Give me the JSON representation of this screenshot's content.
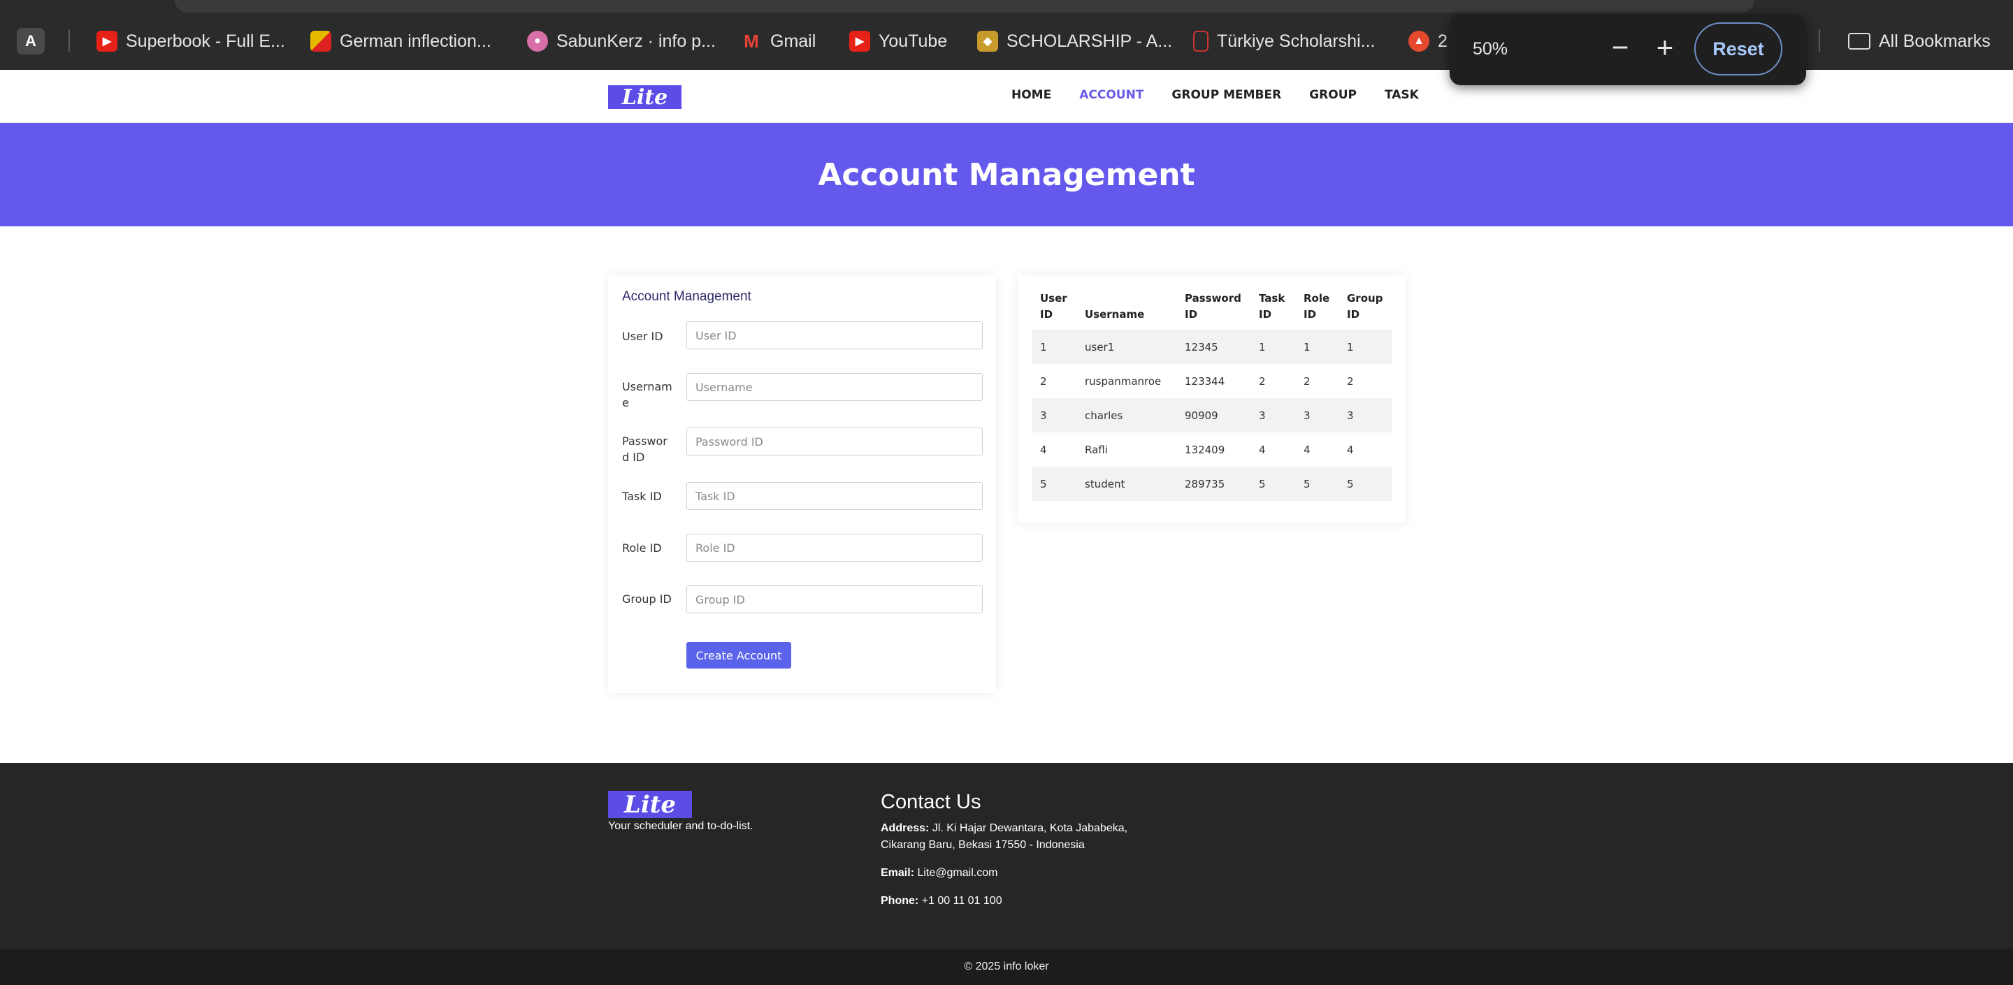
{
  "browser": {
    "profile_initial": "A",
    "bookmarks": [
      {
        "label": "Superbook - Full E...",
        "icon": "youtube-icon"
      },
      {
        "label": "German inflection...",
        "icon": "german-flag-icon"
      },
      {
        "label": "SabunKerz · info p...",
        "icon": "sabunkerz-icon"
      },
      {
        "label": "Gmail",
        "icon": "gmail-icon"
      },
      {
        "label": "YouTube",
        "icon": "youtube-icon"
      },
      {
        "label": "SCHOLARSHIP - A...",
        "icon": "scholarship-icon"
      },
      {
        "label": "Türkiye Scholarshi...",
        "icon": "turkiye-icon"
      },
      {
        "label": "2",
        "icon": "app-icon"
      }
    ],
    "all_bookmarks": "All Bookmarks",
    "zoom": {
      "value": "50%",
      "minus": "−",
      "plus": "+",
      "reset": "Reset"
    }
  },
  "nav": {
    "logo": "Lite",
    "links": [
      "HOME",
      "ACCOUNT",
      "GROUP MEMBER",
      "GROUP",
      "TASK"
    ],
    "active": "ACCOUNT"
  },
  "hero": {
    "title": "Account Management"
  },
  "form": {
    "title": "Account Management",
    "fields": [
      {
        "label": "User ID",
        "placeholder": "User ID",
        "value": ""
      },
      {
        "label": "Username",
        "placeholder": "Username",
        "value": ""
      },
      {
        "label": "Password ID",
        "placeholder": "Password ID",
        "value": ""
      },
      {
        "label": "Task ID",
        "placeholder": "Task ID",
        "value": ""
      },
      {
        "label": "Role ID",
        "placeholder": "Role ID",
        "value": ""
      },
      {
        "label": "Group ID",
        "placeholder": "Group ID",
        "value": ""
      }
    ],
    "submit": "Create Account"
  },
  "table": {
    "headers": [
      "User ID",
      "Username",
      "Password ID",
      "Task ID",
      "Role ID",
      "Group ID"
    ],
    "rows": [
      [
        "1",
        "user1",
        "12345",
        "1",
        "1",
        "1"
      ],
      [
        "2",
        "ruspanmanroe",
        "123344",
        "2",
        "2",
        "2"
      ],
      [
        "3",
        "charles",
        "90909",
        "3",
        "3",
        "3"
      ],
      [
        "4",
        "Rafli",
        "132409",
        "4",
        "4",
        "4"
      ],
      [
        "5",
        "student",
        "289735",
        "5",
        "5",
        "5"
      ]
    ]
  },
  "footer": {
    "logo": "Lite",
    "tagline": "Your scheduler and to-do-list.",
    "contact_title": "Contact Us",
    "address_label": "Address:",
    "address": "Jl. Ki Hajar Dewantara, Kota Jababeka, Cikarang Baru, Bekasi 17550 - Indonesia",
    "email_label": "Email:",
    "email": "Lite@gmail.com",
    "phone_label": "Phone:",
    "phone": "+1 00 11 01 100",
    "copyright": "© 2025 info loker"
  },
  "colors": {
    "accent": "#6459ec",
    "button": "#5a63ea",
    "footer": "#262626"
  }
}
